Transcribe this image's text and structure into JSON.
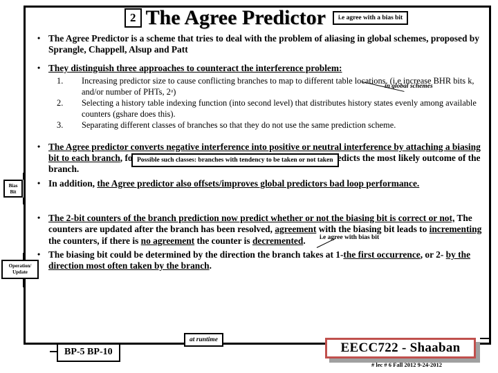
{
  "slide": {
    "number": "2",
    "title": "The Agree Predictor",
    "title_callout": "i.e agree with a bias bit"
  },
  "bullets": [
    {
      "id": "bullet-aliasing",
      "marker": "•",
      "segments": [
        {
          "text": "The Agree Predictor is a scheme that tries to deal with the problem of aliasing in global schemes, proposed by Sprangle, Chappell, Alsup and Patt",
          "underline": false
        }
      ]
    },
    {
      "id": "bullet-three-approaches",
      "marker": "•",
      "segments": [
        {
          "text": "They distinguish three approaches to counteract the interference problem:",
          "underline": true
        }
      ]
    },
    {
      "id": "bullet-converts",
      "marker": "•",
      "segments": [
        {
          "text": "The Agree predictor converts negative interference into positive or neutral interference by attaching a biasing bit to each branch",
          "underline": true
        },
        {
          "text": ", for instance in the BTB or instruction cache, which predicts the most likely outcome of the branch.",
          "underline": false
        }
      ]
    },
    {
      "id": "bullet-in-addition",
      "marker": "•",
      "segments": [
        {
          "text": "In addition, ",
          "underline": false
        },
        {
          "text": "the Agree predictor also offsets/improves global predictors bad loop performance.",
          "underline": true
        }
      ]
    },
    {
      "id": "bullet-two-bit-counters",
      "marker": "•",
      "segments": [
        {
          "text": "The 2-bit counters of the branch prediction now predict whether or not the biasing bit is correct or not,",
          "underline": true
        },
        {
          "text": " The counters are updated after the branch has been resolved, ",
          "underline": false
        },
        {
          "text": "agreement",
          "underline": true
        },
        {
          "text": " with the biasing bit leads to ",
          "underline": false
        },
        {
          "text": "incrementing ",
          "underline": true
        },
        {
          "text": "the counters, if there is ",
          "underline": false
        },
        {
          "text": "no agreement",
          "underline": true
        },
        {
          "text": " the counter is ",
          "underline": false
        },
        {
          "text": "decremented",
          "underline": true
        },
        {
          "text": ".",
          "underline": false
        }
      ]
    },
    {
      "id": "bullet-biasing-bit-determined",
      "marker": "•",
      "segments": [
        {
          "text": "The biasing bit could be determined by the direction the branch takes at 1-",
          "underline": false
        },
        {
          "text": "the first occurrence",
          "underline": true
        },
        {
          "text": ", or 2- ",
          "underline": false
        },
        {
          "text": "by the direction most often taken by the branch",
          "underline": true
        },
        {
          "text": ".",
          "underline": false
        }
      ]
    }
  ],
  "numbered_list": [
    {
      "number": "1.",
      "text": "Increasing predictor size to cause conflicting branches to map to different table locations. (i.e increase BHR bits k, and/or number of PHTs, 2ᵃ)"
    },
    {
      "number": "2.",
      "text": "Selecting a history table indexing function (into second level) that distributes history states evenly among available counters (gshare does this)."
    },
    {
      "number": "3.",
      "text": "Separating different classes of branches so that they do not use the same prediction scheme."
    }
  ],
  "annotations": {
    "in_global_schemes": "in global schemes",
    "possible_classes": "Possible such classes: branches with tendency to be taken or not taken",
    "ie_agree_with_bias_bit": "i.e agree with bias bit",
    "at_runtime": "at runtime"
  },
  "side_labels": [
    {
      "id": "bias-bit",
      "line1": "Bias",
      "line2": "Bit"
    },
    {
      "id": "operation-update",
      "line1": "Operation/",
      "line2": "Update"
    }
  ],
  "bottom": {
    "bp_tags": "BP-5   BP-10",
    "course_stamp": "EECC722 - Shaaban",
    "course_sub": "#  lec # 6   Fall 2012   9-24-2012"
  },
  "colors": {
    "stamp_border": "#c0504d",
    "stamp_shadow": "#a0a0a0",
    "ink": "#000000",
    "page": "#ffffff"
  }
}
